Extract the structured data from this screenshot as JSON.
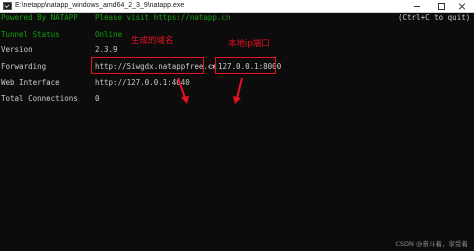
{
  "window": {
    "title": "E:\\netapp\\natapp_windows_amd64_2_3_9\\natapp.exe"
  },
  "console": {
    "powered_by": "Powered By NATAPP",
    "visit_text": "Please visit https://natapp.cn",
    "quit_hint": "(Ctrl+C to quit)",
    "rows": [
      {
        "label": "Tunnel Status",
        "value": "Online"
      },
      {
        "label": "Version",
        "value": "2.3.9"
      },
      {
        "label": "Forwarding",
        "value": "http://5iwgdx.natappfree.cc",
        "arrow": "->",
        "target": "127.0.0.1:8000"
      },
      {
        "label": "Web Interface",
        "value": "http://127.0.0.1:4040"
      },
      {
        "label": "Total Connections",
        "value": "0"
      }
    ]
  },
  "annotations": {
    "domain_label": "生成的域名",
    "port_label": "本地ip端口",
    "color": "#e81123"
  },
  "watermark": "CSDN @奋斗着，享受着"
}
